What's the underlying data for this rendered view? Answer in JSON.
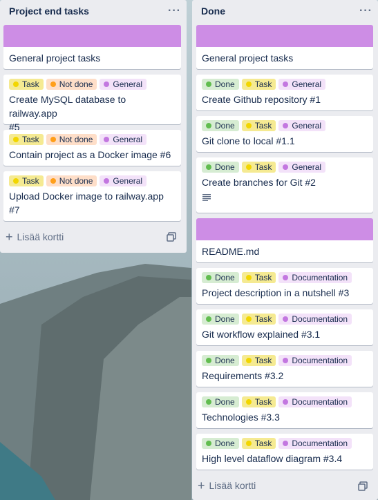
{
  "colors": {
    "cover": "#cd8de5",
    "task": "#f5ea92",
    "task_dot": "#f2d600",
    "not_done": "#fedec8",
    "not_done_dot": "#ff9f1a",
    "general": "#f3e2f9",
    "general_dot": "#c377e0",
    "done": "#d6ecd2",
    "done_dot": "#61bd4f",
    "documentation": "#f3e2f9",
    "documentation_dot": "#c377e0"
  },
  "left_list": {
    "title": "Project end tasks",
    "menu_icon": "ellipsis-icon",
    "cover_card": {
      "title": "General project tasks"
    },
    "cards": [
      {
        "labels": [
          "Task",
          "Not done",
          "General"
        ],
        "title_lines": [
          "Create MySQL database to railway.app",
          "#5"
        ]
      },
      {
        "labels": [
          "Task",
          "Not done",
          "General"
        ],
        "title_lines": [
          "Contain project as a Docker image #6"
        ]
      },
      {
        "labels": [
          "Task",
          "Not done",
          "General"
        ],
        "title_lines": [
          "Upload Docker image to railway.app",
          "#7"
        ]
      }
    ],
    "add_card": "Lisää kortti"
  },
  "right_list": {
    "title": "Done",
    "menu_icon": "ellipsis-icon",
    "cover_card_1": {
      "title": "General project tasks"
    },
    "cards_1": [
      {
        "labels": [
          "Done",
          "Task",
          "General"
        ],
        "title": "Create Github repository #1"
      },
      {
        "labels": [
          "Done",
          "Task",
          "General"
        ],
        "title": "Git clone to local #1.1"
      },
      {
        "labels": [
          "Done",
          "Task",
          "General"
        ],
        "title": "Create branches for Git #2"
      }
    ],
    "cover_card_2": {
      "title": "README.md"
    },
    "cards_2": [
      {
        "labels": [
          "Done",
          "Task",
          "Documentation"
        ],
        "title": "Project description in a nutshell #3"
      },
      {
        "labels": [
          "Done",
          "Task",
          "Documentation"
        ],
        "title": "Git workflow explained #3.1"
      },
      {
        "labels": [
          "Done",
          "Task",
          "Documentation"
        ],
        "title": "Requirements #3.2"
      },
      {
        "labels": [
          "Done",
          "Task",
          "Documentation"
        ],
        "title": "Technologies #3.3"
      },
      {
        "labels": [
          "Done",
          "Task",
          "Documentation"
        ],
        "title": "High level dataflow diagram #3.4"
      }
    ],
    "add_card": "Lisää kortti"
  }
}
